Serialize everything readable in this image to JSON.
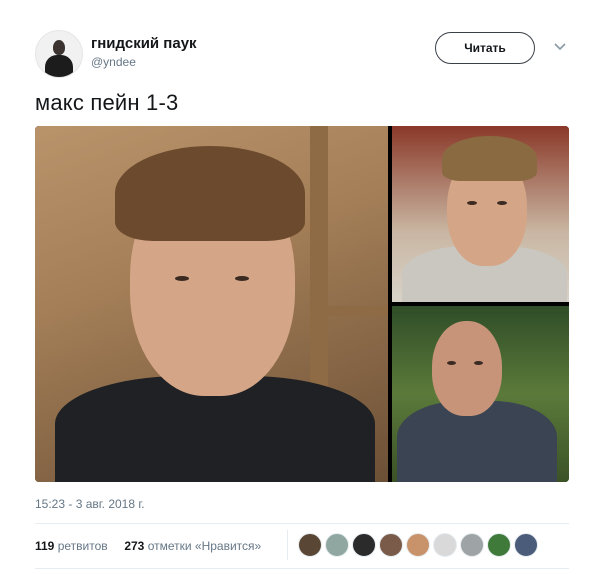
{
  "user": {
    "display_name": "гнидский паук",
    "handle": "@yndee",
    "avatar_icon": "user-avatar-icon"
  },
  "follow_button": {
    "label": "Читать"
  },
  "menu_icon": "chevron-down-icon",
  "tweet": {
    "text": "макс пейн 1-3",
    "timestamp": "15:23 - 3 авг. 2018 г."
  },
  "stats": {
    "retweets_count": "119",
    "retweets_label": "ретвитов",
    "likes_count": "273",
    "likes_label": "отметки «Нравится»"
  },
  "liker_colors": [
    "#5a4634",
    "#8fa7a0",
    "#2b2b2b",
    "#7a5a48",
    "#c8926b",
    "#d9d9d9",
    "#9ea3a6",
    "#3f7a3a",
    "#4a5c7a"
  ],
  "colors": {
    "text": "#14171a",
    "secondary": "#657786",
    "divider": "#e6ecf0"
  }
}
